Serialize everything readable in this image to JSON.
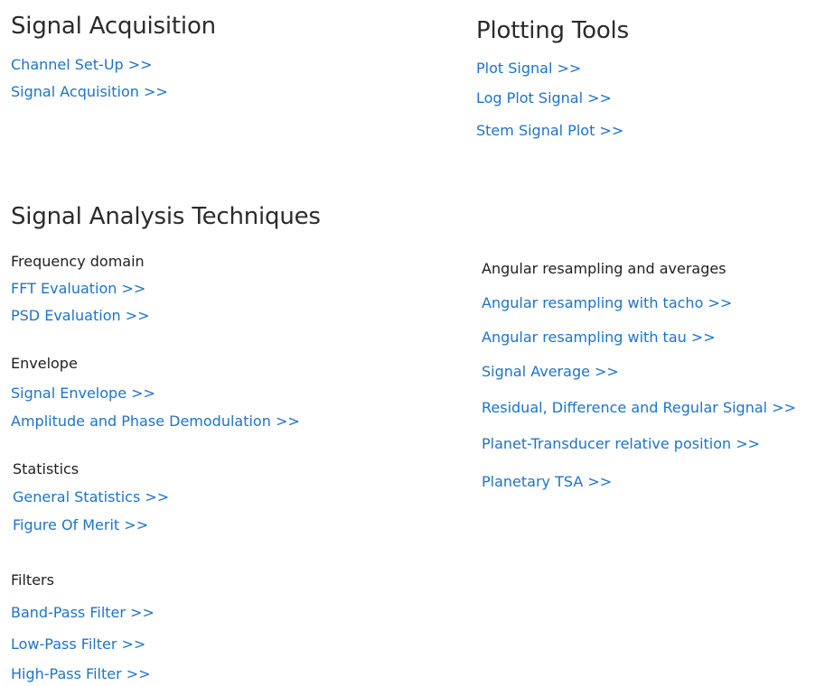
{
  "sections": {
    "signal_acquisition": {
      "title": "Signal Acquisition",
      "links": [
        "Channel Set-Up >>",
        "Signal Acquisition >>"
      ]
    },
    "plotting_tools": {
      "title": "Plotting Tools",
      "links": [
        "Plot Signal >>",
        "Log Plot Signal >>",
        "Stem Signal Plot >>"
      ]
    },
    "analysis": {
      "title": "Signal Analysis Techniques",
      "frequency": {
        "heading": "Frequency domain",
        "links": [
          "FFT Evaluation >>",
          "PSD Evaluation >>"
        ]
      },
      "envelope": {
        "heading": "Envelope",
        "links": [
          "Signal Envelope >>",
          "Amplitude and Phase Demodulation >>"
        ]
      },
      "statistics": {
        "heading": "Statistics",
        "links": [
          "General Statistics >>",
          "Figure Of Merit >>"
        ]
      },
      "filters": {
        "heading": "Filters",
        "links": [
          "Band-Pass Filter >>",
          "Low-Pass Filter >>",
          "High-Pass Filter >>"
        ]
      },
      "angular": {
        "heading": "Angular resampling and averages",
        "links": [
          "Angular resampling with tacho >>",
          "Angular resampling with tau >>",
          "Signal Average >>",
          "Residual, Difference and Regular Signal >>",
          "Planet-Transducer relative position >>",
          "Planetary TSA >>"
        ]
      }
    }
  },
  "colors": {
    "link": "#1e73c8",
    "title": "#2b2b2b",
    "heading": "#1f1f1f"
  }
}
